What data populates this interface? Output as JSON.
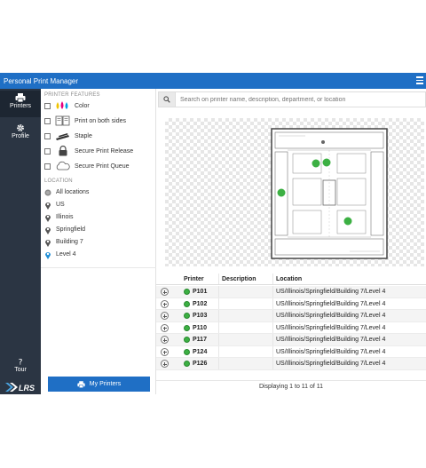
{
  "app": {
    "title": "Personal Print Manager"
  },
  "nav": {
    "printers": "Printers",
    "profile": "Profile",
    "tour": "Tour"
  },
  "filters": {
    "features_title": "PRINTER FEATURES",
    "features": [
      {
        "label": "Color",
        "icon": "color-ink-icon",
        "checked": false
      },
      {
        "label": "Print on both sides",
        "icon": "duplex-icon",
        "checked": false
      },
      {
        "label": "Staple",
        "icon": "staple-icon",
        "checked": false
      },
      {
        "label": "Secure Print Release",
        "icon": "lock-icon",
        "checked": false
      },
      {
        "label": "Secure Print Queue",
        "icon": "cloud-icon",
        "checked": false
      }
    ],
    "location_title": "LOCATION",
    "locations": [
      {
        "label": "All locations",
        "icon": "globe-icon"
      },
      {
        "label": "US",
        "icon": "pin-icon"
      },
      {
        "label": "Illinois",
        "icon": "pin-icon"
      },
      {
        "label": "Springfield",
        "icon": "pin-icon"
      },
      {
        "label": "Building 7",
        "icon": "pin-icon"
      },
      {
        "label": "Level 4",
        "icon": "pin-icon-active"
      }
    ],
    "my_printers_label": "My Printers"
  },
  "search": {
    "placeholder": "Search on printer name, description, department, or location"
  },
  "table": {
    "headers": {
      "printer": "Printer",
      "description": "Description",
      "location": "Location"
    },
    "rows": [
      {
        "printer": "P101",
        "description": "",
        "location": "US/Illinois/Springfield/Building 7/Level 4"
      },
      {
        "printer": "P102",
        "description": "",
        "location": "US/Illinois/Springfield/Building 7/Level 4"
      },
      {
        "printer": "P103",
        "description": "",
        "location": "US/Illinois/Springfield/Building 7/Level 4"
      },
      {
        "printer": "P110",
        "description": "",
        "location": "US/Illinois/Springfield/Building 7/Level 4"
      },
      {
        "printer": "P117",
        "description": "",
        "location": "US/Illinois/Springfield/Building 7/Level 4"
      },
      {
        "printer": "P124",
        "description": "",
        "location": "US/Illinois/Springfield/Building 7/Level 4"
      },
      {
        "printer": "P126",
        "description": "",
        "location": "US/Illinois/Springfield/Building 7/Level 4"
      }
    ],
    "footer": "Displaying 1 to 11 of 11"
  },
  "colors": {
    "accent": "#1f6fc5",
    "nav_bg": "#2b3543",
    "status_online": "#3cb043"
  }
}
